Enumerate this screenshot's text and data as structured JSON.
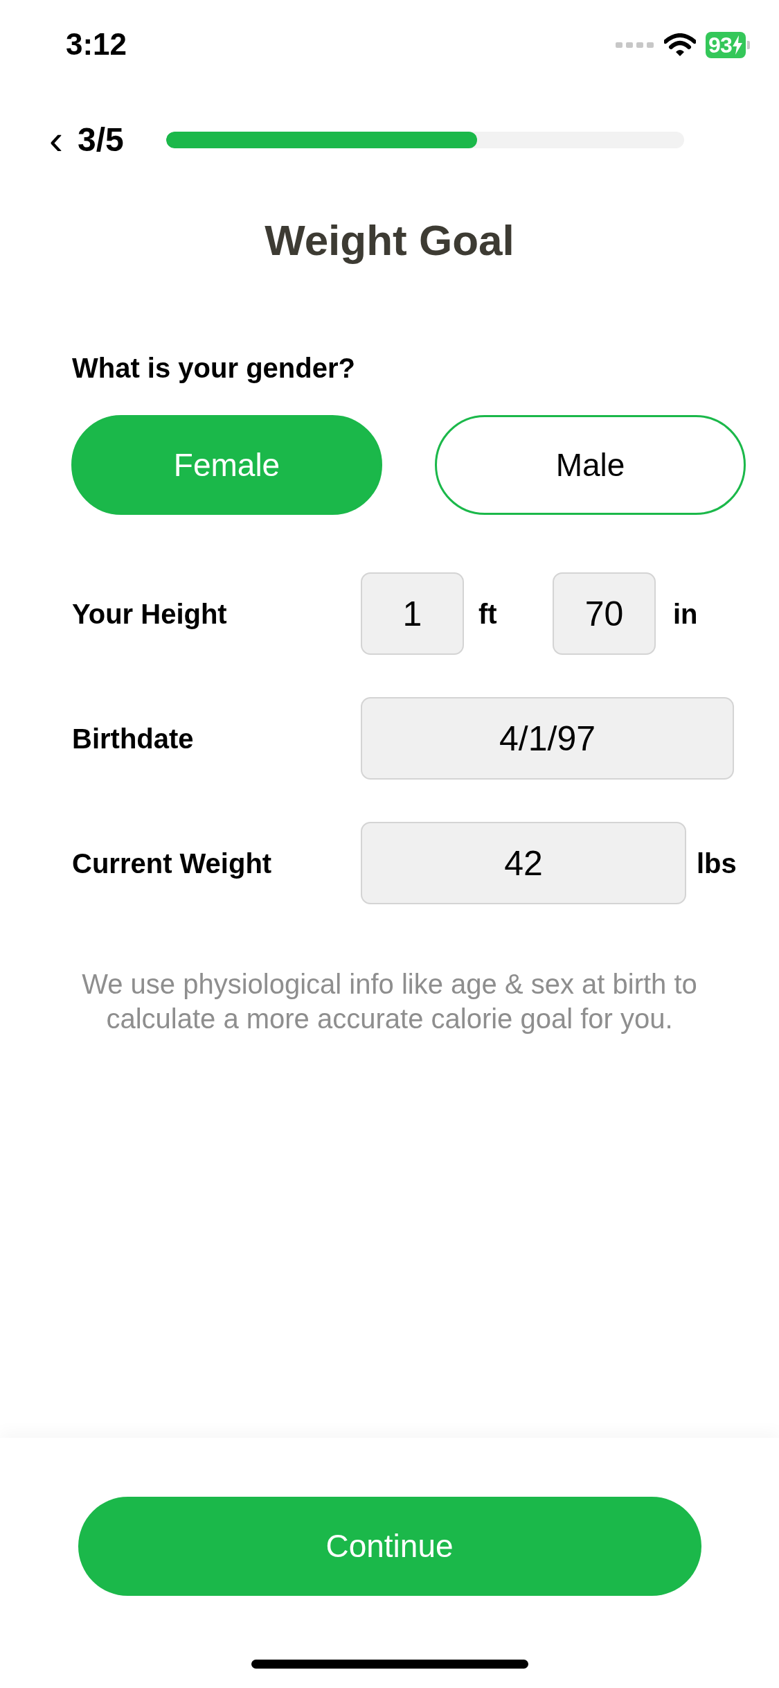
{
  "status_bar": {
    "time": "3:12",
    "battery": "93"
  },
  "header": {
    "back": "‹",
    "step": "3/5",
    "progress": {
      "level": 0.6
    }
  },
  "title": "Weight Goal",
  "gender": {
    "question": "What is your gender?",
    "options": [
      {
        "label": "Female",
        "selected": true
      },
      {
        "label": "Male",
        "selected": false
      }
    ]
  },
  "fields": [
    {
      "kind": "height",
      "label": "Your Height",
      "parts": [
        {
          "value": "1",
          "unit": "ft"
        },
        {
          "value": "70",
          "unit": "in"
        }
      ]
    },
    {
      "kind": "date",
      "label": "Birthdate",
      "value": "4/1/97"
    },
    {
      "kind": "weight",
      "label": "Current Weight",
      "value": "42",
      "unit": "lbs"
    }
  ],
  "note": "We use physiological info like age & sex at birth to calculate a more accurate calorie goal for you.",
  "continue_button": "Continue"
}
